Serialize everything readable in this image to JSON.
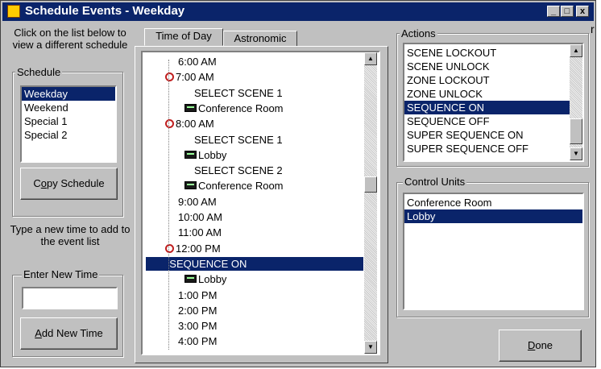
{
  "window": {
    "title": "Schedule Events - Weekday",
    "minimize_glyph": "_",
    "maximize_glyph": "□",
    "close_glyph": "x"
  },
  "left": {
    "instruction": "Click on the list below to view a different schedule",
    "schedule_legend": "Schedule",
    "schedules": [
      "Weekday",
      "Weekend",
      "Special 1",
      "Special 2"
    ],
    "copy_button": "Copy Schedule",
    "new_time_instruction": "Type a new time to add to the event list",
    "enter_time_legend": "Enter New Time",
    "enter_time_value": "",
    "add_button": "Add New Time"
  },
  "tabs": [
    "Time of Day",
    "Astronomic"
  ],
  "tree": [
    {
      "text": "6:00 AM",
      "level": 0,
      "icon": "none"
    },
    {
      "text": "7:00 AM",
      "level": 0,
      "icon": "clock-icon"
    },
    {
      "text": "SELECT SCENE 1",
      "level": 1,
      "icon": "none"
    },
    {
      "text": "Conference Room",
      "level": 2,
      "icon": "control-unit-icon"
    },
    {
      "text": "8:00 AM",
      "level": 0,
      "icon": "clock-icon"
    },
    {
      "text": "SELECT SCENE 1",
      "level": 1,
      "icon": "none"
    },
    {
      "text": "Lobby",
      "level": 2,
      "icon": "control-unit-icon"
    },
    {
      "text": "SELECT SCENE 2",
      "level": 1,
      "icon": "none"
    },
    {
      "text": "Conference Room",
      "level": 2,
      "icon": "control-unit-icon"
    },
    {
      "text": "9:00 AM",
      "level": 0,
      "icon": "none"
    },
    {
      "text": "10:00 AM",
      "level": 0,
      "icon": "none"
    },
    {
      "text": "11:00 AM",
      "level": 0,
      "icon": "none"
    },
    {
      "text": "12:00 PM",
      "level": 0,
      "icon": "clock-icon"
    },
    {
      "text": "SEQUENCE ON",
      "level": 1,
      "icon": "none",
      "selected": true
    },
    {
      "text": "Lobby",
      "level": 2,
      "icon": "control-unit-icon"
    },
    {
      "text": "1:00 PM",
      "level": 0,
      "icon": "none"
    },
    {
      "text": "2:00 PM",
      "level": 0,
      "icon": "none"
    },
    {
      "text": "3:00 PM",
      "level": 0,
      "icon": "none"
    },
    {
      "text": "4:00 PM",
      "level": 0,
      "icon": "none"
    }
  ],
  "actions": {
    "legend": "Actions",
    "items": [
      "SCENE LOCKOUT",
      "SCENE UNLOCK",
      "ZONE LOCKOUT",
      "ZONE UNLOCK",
      "SEQUENCE ON",
      "SEQUENCE OFF",
      "SUPER SEQUENCE ON",
      "SUPER SEQUENCE OFF"
    ],
    "selected": "SEQUENCE ON"
  },
  "control_units": {
    "legend": "Control Units",
    "items": [
      "Conference Room",
      "Lobby"
    ],
    "selected": "Lobby"
  },
  "done_button": "Done",
  "stray_char": "r"
}
